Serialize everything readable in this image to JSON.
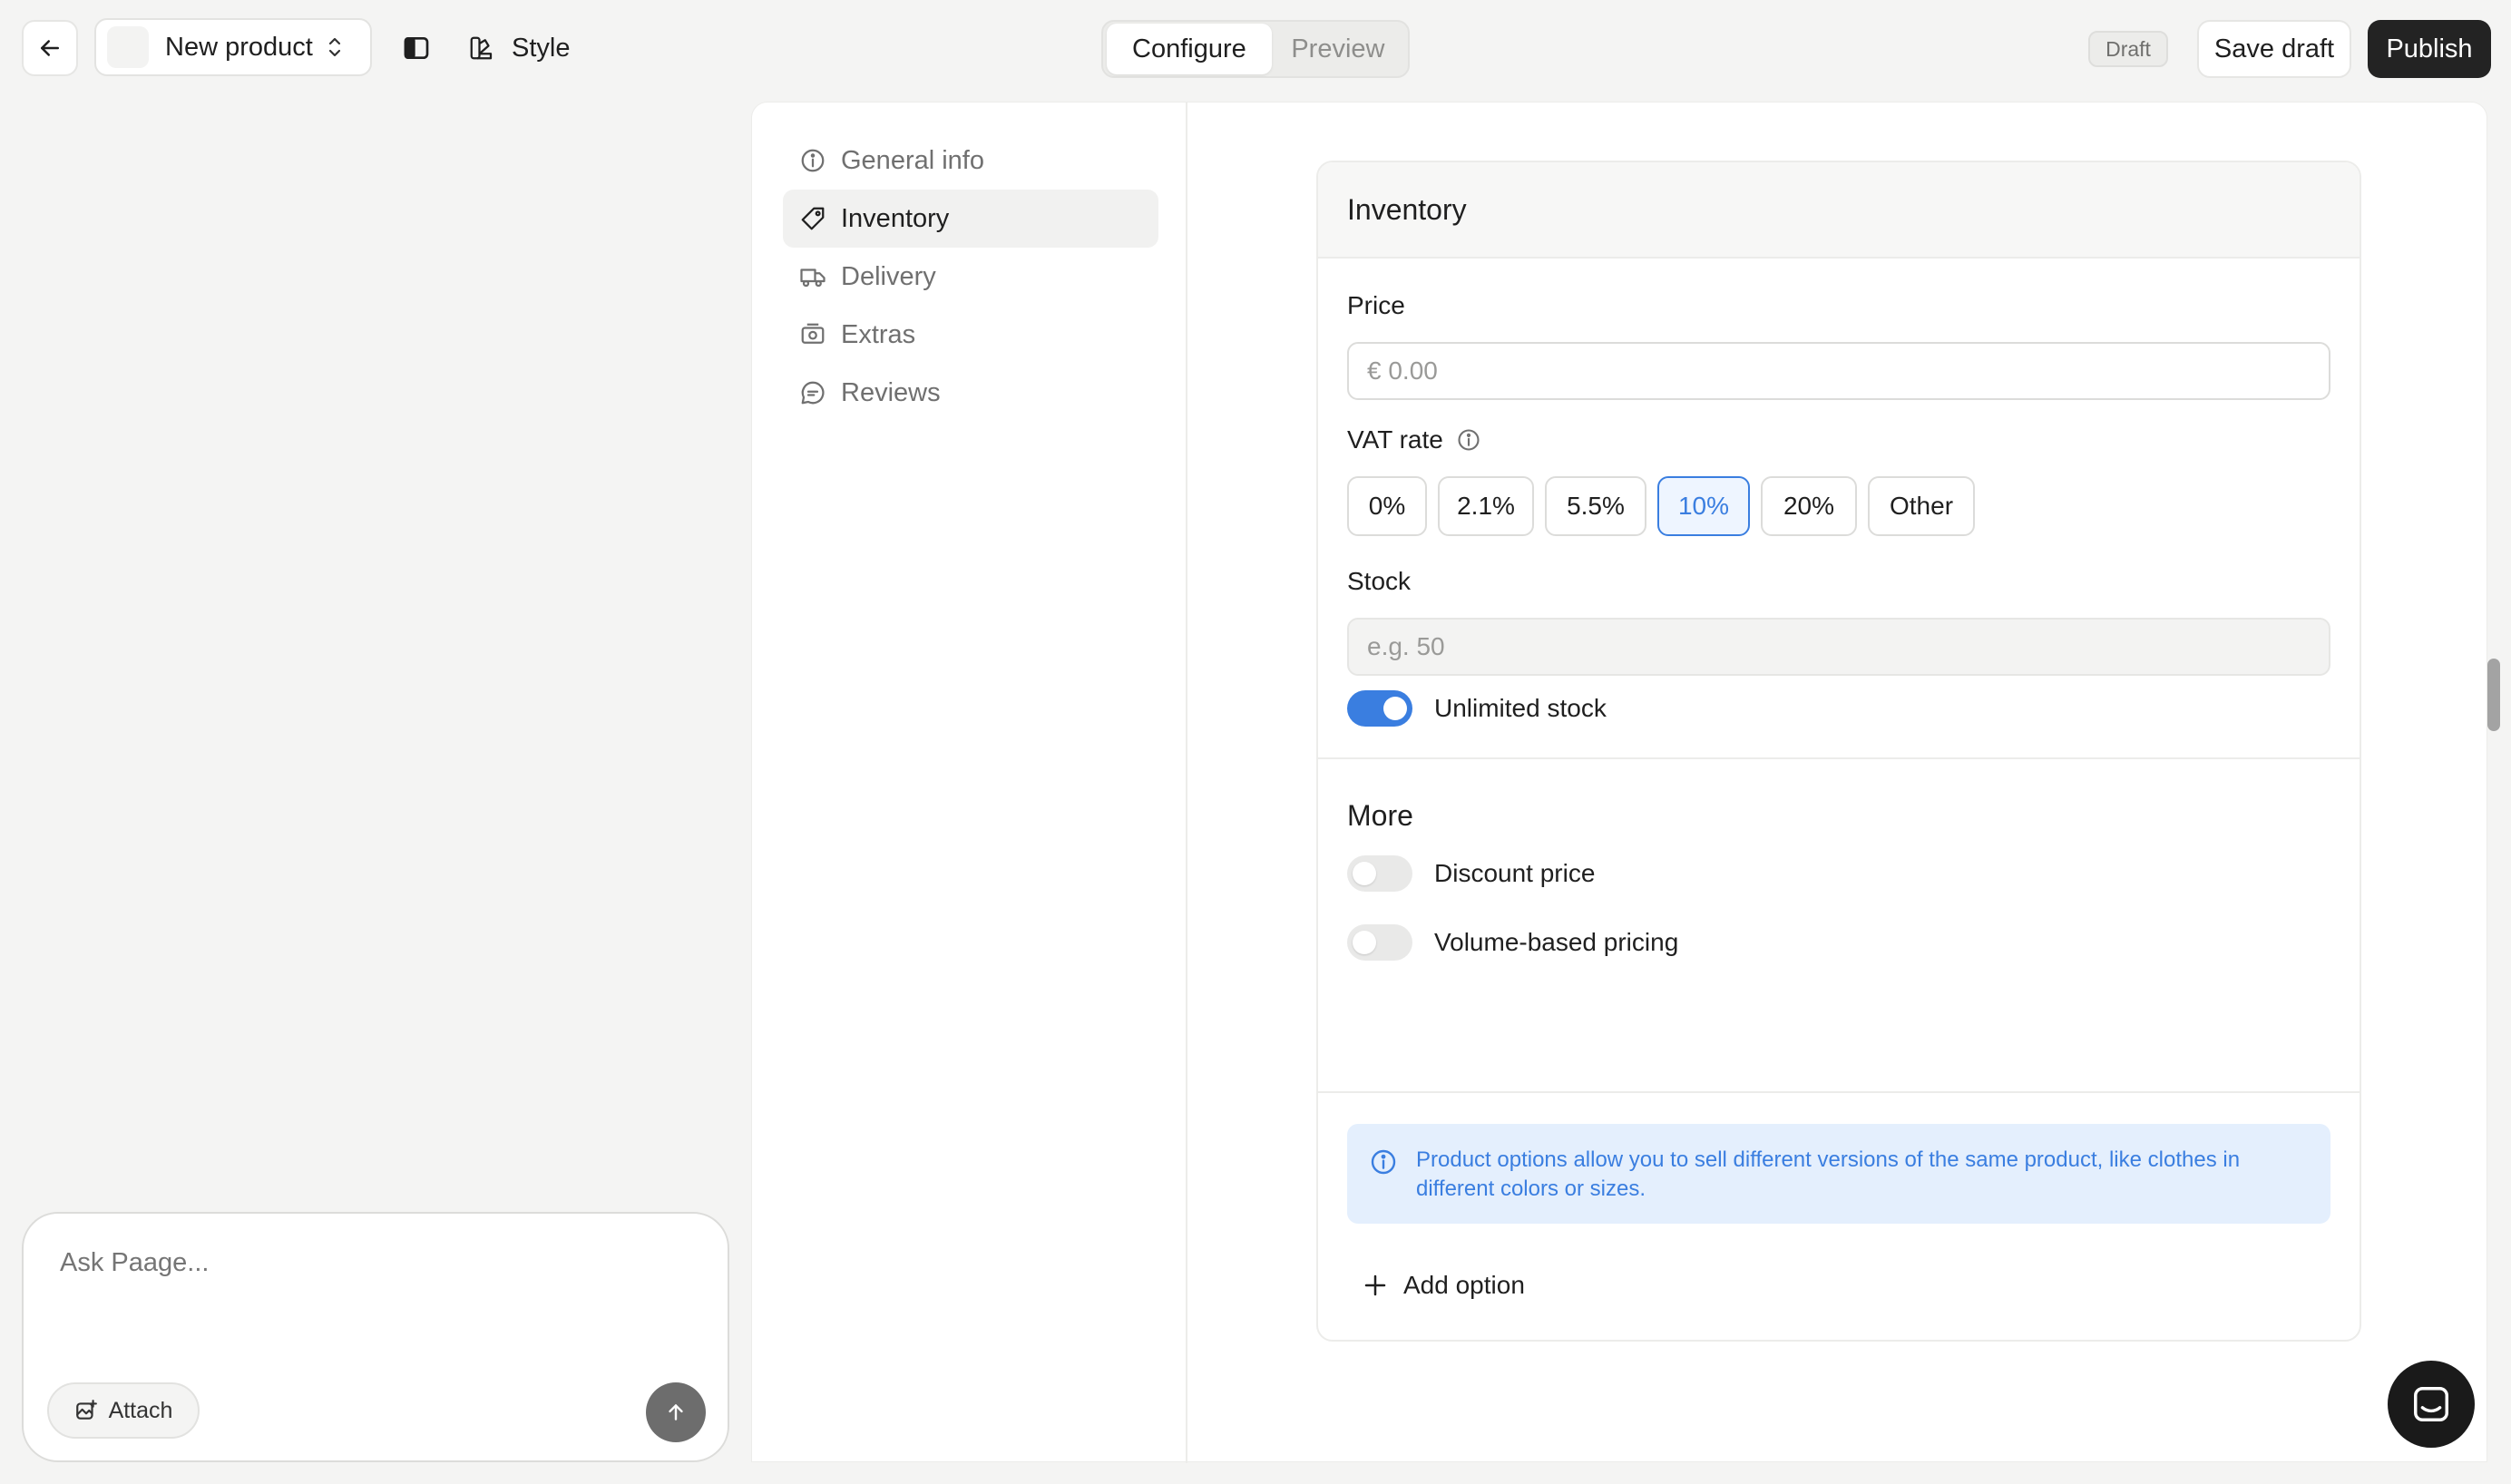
{
  "topbar": {
    "product_name": "New product",
    "style_label": "Style",
    "modes": {
      "configure": "Configure",
      "preview": "Preview"
    },
    "status_badge": "Draft",
    "save_draft_label": "Save draft",
    "publish_label": "Publish"
  },
  "chat": {
    "placeholder": "Ask Paage...",
    "attach_label": "Attach"
  },
  "nav": {
    "items": [
      {
        "label": "General info",
        "icon": "info-circle-icon",
        "active": false
      },
      {
        "label": "Inventory",
        "icon": "tag-icon",
        "active": true
      },
      {
        "label": "Delivery",
        "icon": "truck-icon",
        "active": false
      },
      {
        "label": "Extras",
        "icon": "gift-icon",
        "active": false
      },
      {
        "label": "Reviews",
        "icon": "chat-bubble-icon",
        "active": false
      }
    ]
  },
  "inventory": {
    "title": "Inventory",
    "price": {
      "label": "Price",
      "placeholder": "€ 0.00"
    },
    "vat": {
      "label": "VAT rate",
      "options": [
        "0%",
        "2.1%",
        "5.5%",
        "10%",
        "20%",
        "Other"
      ],
      "selected": "10%"
    },
    "stock": {
      "label": "Stock",
      "placeholder": "e.g. 50",
      "unlimited_label": "Unlimited stock",
      "unlimited_on": true
    },
    "more": {
      "title": "More",
      "discount_label": "Discount price",
      "discount_on": false,
      "volume_label": "Volume-based pricing",
      "volume_on": false
    },
    "options_info": "Product options allow you to sell different versions of the same product, like clothes in different colors or sizes.",
    "add_option_label": "Add option"
  },
  "colors": {
    "accent": "#3a7ee0",
    "publish_bg": "#232323",
    "info_bg": "#e4effd"
  }
}
